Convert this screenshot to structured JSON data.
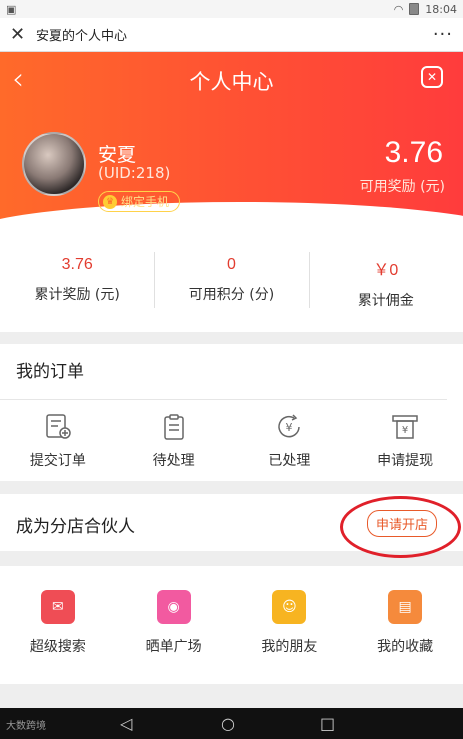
{
  "status_bar": {
    "time": "18:04"
  },
  "webview": {
    "title": "安夏的个人中心",
    "more": "···"
  },
  "header": {
    "title": "个人中心"
  },
  "user": {
    "name": "安夏",
    "uid": "(UID:218)",
    "bind_phone": "绑定手机",
    "available_reward_value": "3.76",
    "available_reward_label": "可用奖励 (元)"
  },
  "stats": [
    {
      "value": "3.76",
      "label": "累计奖励 (元)"
    },
    {
      "value": "0",
      "label": "可用积分 (分)"
    },
    {
      "value": "￥0",
      "label": "累计佣金"
    }
  ],
  "orders": {
    "title": "我的订单",
    "items": [
      {
        "label": "提交订单",
        "icon": "submit-order-icon"
      },
      {
        "label": "待处理",
        "icon": "clipboard-icon"
      },
      {
        "label": "已处理",
        "icon": "yen-refresh-icon"
      },
      {
        "label": "申请提现",
        "icon": "yen-withdraw-icon"
      }
    ]
  },
  "partner": {
    "title": "成为分店合伙人",
    "apply": "申请开店"
  },
  "tools": [
    {
      "label": "超级搜索",
      "icon": "red-envelope-icon",
      "color": "#ef4d55"
    },
    {
      "label": "晒单广场",
      "icon": "camera-icon",
      "color": "#f25aa0"
    },
    {
      "label": "我的朋友",
      "icon": "friend-icon",
      "color": "#f7b421"
    },
    {
      "label": "我的收藏",
      "icon": "favorites-icon",
      "color": "#f58a3c"
    }
  ],
  "navbar": {
    "brand": "大数跨境"
  }
}
